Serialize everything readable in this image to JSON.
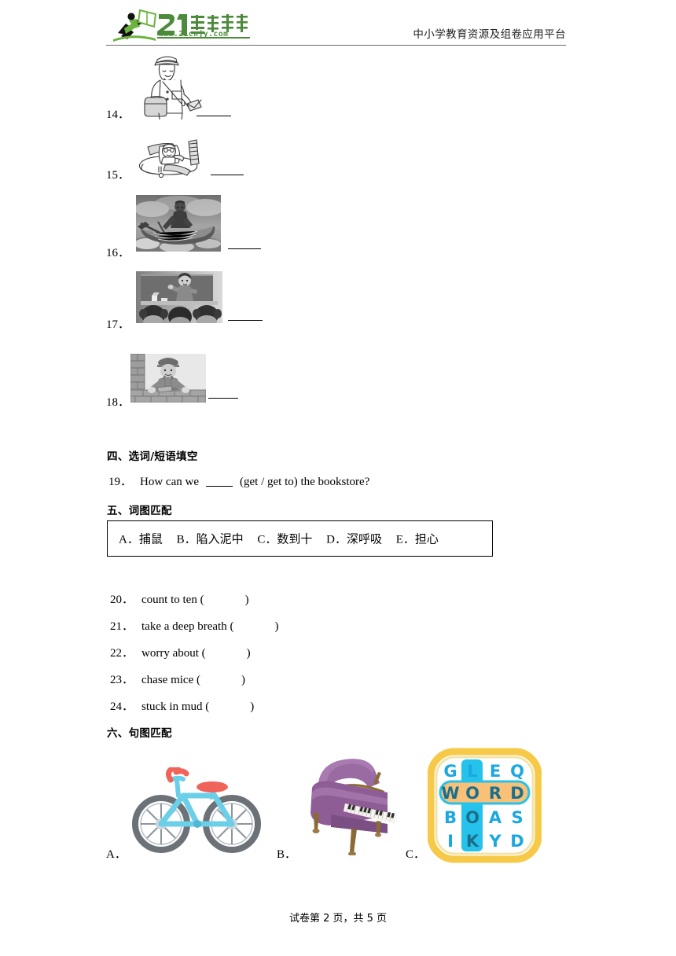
{
  "header": {
    "logo_text": "21世纪教育",
    "logo_url": "www.21cnjy.com",
    "tagline": "中小学教育资源及组卷应用平台"
  },
  "picture_items": [
    {
      "number": "14．",
      "image_name": "postman-line-drawing",
      "blank": ""
    },
    {
      "number": "15．",
      "image_name": "pilot-in-plane-line-drawing",
      "blank": ""
    },
    {
      "number": "16．",
      "image_name": "fisherman-rowing-boat-photo",
      "blank": ""
    },
    {
      "number": "17．",
      "image_name": "teacher-at-blackboard-photo",
      "blank": ""
    },
    {
      "number": "18．",
      "image_name": "builder-laying-bricks-photo",
      "blank": ""
    }
  ],
  "section_four": {
    "heading": "四、选词/短语填空",
    "question": {
      "number": "19．",
      "before_blank": "How can we",
      "after_blank": "(get / get to) the bookstore?"
    }
  },
  "section_five": {
    "heading": "五、词图匹配",
    "options": [
      "A．捕鼠",
      "B．陷入泥中",
      "C．数到十",
      "D．深呼吸",
      "E．担心"
    ],
    "questions": [
      {
        "number": "20．",
        "text": "count to ten (",
        "close": ")"
      },
      {
        "number": "21．",
        "text": "take a deep breath (",
        "close": ")"
      },
      {
        "number": "22．",
        "text": "worry about (",
        "close": ")"
      },
      {
        "number": "23．",
        "text": "chase mice (",
        "close": ")"
      },
      {
        "number": "24．",
        "text": "stuck in mud (",
        "close": ")"
      }
    ]
  },
  "section_six": {
    "heading": "六、句图匹配",
    "choices": [
      {
        "label": "A．",
        "image_name": "bicycle-illustration"
      },
      {
        "label": "B．",
        "image_name": "grand-piano-illustration"
      },
      {
        "label": "C．",
        "image_name": "word-search-puzzle-icon"
      }
    ]
  },
  "word_search": {
    "grid": [
      [
        "G",
        "L",
        "E",
        "Q"
      ],
      [
        "W",
        "O",
        "R",
        "D"
      ],
      [
        "B",
        "O",
        "A",
        "S"
      ],
      [
        "I",
        "K",
        "Y",
        "D"
      ]
    ],
    "highlight_row_index": 1,
    "highlight_col_index": 1
  },
  "colors": {
    "logo_green": "#4b8b3b",
    "bike_body": "#6ccfe8",
    "bike_accent": "#f0635a",
    "bike_wheel": "#6d7278",
    "piano_body": "#8e5d96",
    "piano_top": "#9a6ba2",
    "piano_leg": "#8a6a35",
    "puzzle_border": "#f7c948",
    "puzzle_cyan": "#25c3ec",
    "puzzle_orange": "#f8c177",
    "puzzle_letter": "#1ba8e0"
  },
  "footer": {
    "text": "试卷第 2 页，共 5 页"
  }
}
